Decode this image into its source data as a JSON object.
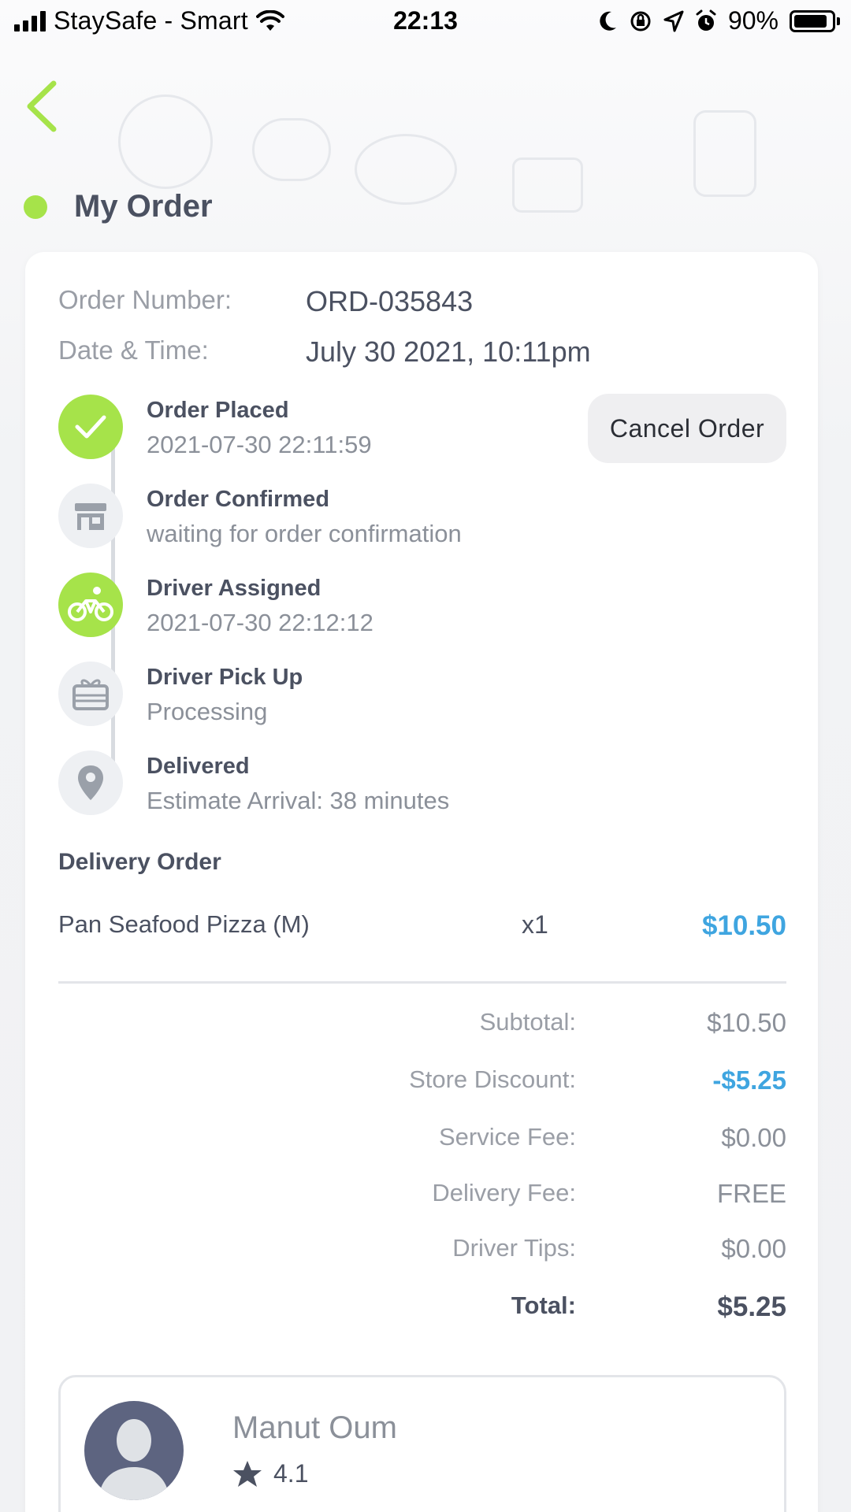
{
  "status_bar": {
    "carrier": "StaySafe - Smart",
    "time": "22:13",
    "battery": "90%",
    "battery_level": 0.9
  },
  "header": {
    "title": "My Order",
    "accent": "#a6e34a"
  },
  "order": {
    "number_label": "Order Number:",
    "number": "ORD-035843",
    "datetime_label": "Date & Time:",
    "datetime": "July 30 2021, 10:11pm"
  },
  "cancel_label": "Cancel Order",
  "timeline": [
    {
      "title": "Order Placed",
      "subtitle": "2021-07-30 22:11:59",
      "icon": "check-icon",
      "done": true
    },
    {
      "title": "Order Confirmed",
      "subtitle": "waiting for order confirmation",
      "icon": "store-icon",
      "done": false
    },
    {
      "title": "Driver Assigned",
      "subtitle": "2021-07-30 22:12:12",
      "icon": "bicycle-icon",
      "done": true
    },
    {
      "title": "Driver Pick Up",
      "subtitle": "Processing",
      "icon": "gift-box-icon",
      "done": false
    },
    {
      "title": "Delivered",
      "subtitle": "Estimate Arrival: 38 minutes",
      "icon": "location-pin-icon",
      "done": false
    }
  ],
  "delivery": {
    "section_title": "Delivery Order",
    "items": [
      {
        "name": "Pan Seafood Pizza (M)",
        "qty": "x1",
        "price": "$10.50"
      }
    ]
  },
  "summary": [
    {
      "label": "Subtotal:",
      "value": "$10.50"
    },
    {
      "label": "Store Discount:",
      "value": "-$5.25"
    },
    {
      "label": "Service Fee:",
      "value": "$0.00"
    },
    {
      "label": "Delivery Fee:",
      "value": "FREE"
    },
    {
      "label": "Driver Tips:",
      "value": "$0.00"
    },
    {
      "label": "Total:",
      "value": "$5.25"
    }
  ],
  "driver": {
    "name": "Manut Oum",
    "rating": "4.1"
  },
  "colors": {
    "green": "#a6e34a",
    "blue": "#3fa5e0",
    "text": "#4b5161",
    "muted": "#9a9ea6"
  }
}
